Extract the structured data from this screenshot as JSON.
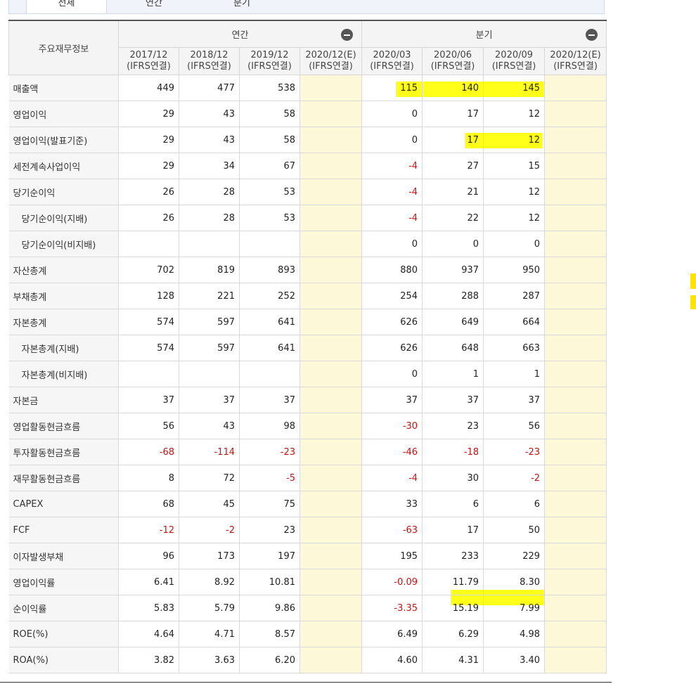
{
  "tabs": [
    {
      "label": "전체"
    },
    {
      "label": "연간"
    },
    {
      "label": "분기"
    }
  ],
  "header": {
    "main_label": "주요재무정보",
    "annual_label": "연간",
    "quarter_label": "분기",
    "periods": [
      {
        "date": "2017/12",
        "basis": "(IFRS연결)"
      },
      {
        "date": "2018/12",
        "basis": "(IFRS연결)"
      },
      {
        "date": "2019/12",
        "basis": "(IFRS연결)"
      },
      {
        "date": "2020/12(E)",
        "basis": "(IFRS연결)"
      },
      {
        "date": "2020/03",
        "basis": "(IFRS연결)"
      },
      {
        "date": "2020/06",
        "basis": "(IFRS연결)"
      },
      {
        "date": "2020/09",
        "basis": "(IFRS연결)"
      },
      {
        "date": "2020/12(E)",
        "basis": "(IFRS연결)"
      }
    ]
  },
  "rows": [
    {
      "label": "매출액",
      "values": [
        "449",
        "477",
        "538",
        "",
        "115",
        "140",
        "145",
        ""
      ]
    },
    {
      "label": "영업이익",
      "values": [
        "29",
        "43",
        "58",
        "",
        "0",
        "17",
        "12",
        ""
      ]
    },
    {
      "label": "영업이익(발표기준)",
      "values": [
        "29",
        "43",
        "58",
        "",
        "0",
        "17",
        "12",
        ""
      ]
    },
    {
      "label": "세전계속사업이익",
      "values": [
        "29",
        "34",
        "67",
        "",
        "-4",
        "27",
        "15",
        ""
      ]
    },
    {
      "label": "당기순이익",
      "values": [
        "26",
        "28",
        "53",
        "",
        "-4",
        "21",
        "12",
        ""
      ]
    },
    {
      "label": "당기순이익(지배)",
      "values": [
        "26",
        "28",
        "53",
        "",
        "-4",
        "22",
        "12",
        ""
      ]
    },
    {
      "label": "당기순이익(비지배)",
      "values": [
        "",
        "",
        "",
        "",
        "0",
        "0",
        "0",
        ""
      ]
    },
    {
      "label": "자산총계",
      "values": [
        "702",
        "819",
        "893",
        "",
        "880",
        "937",
        "950",
        ""
      ]
    },
    {
      "label": "부채총계",
      "values": [
        "128",
        "221",
        "252",
        "",
        "254",
        "288",
        "287",
        ""
      ]
    },
    {
      "label": "자본총계",
      "values": [
        "574",
        "597",
        "641",
        "",
        "626",
        "649",
        "664",
        ""
      ]
    },
    {
      "label": "자본총계(지배)",
      "values": [
        "574",
        "597",
        "641",
        "",
        "626",
        "648",
        "663",
        ""
      ]
    },
    {
      "label": "자본총계(비지배)",
      "values": [
        "",
        "",
        "",
        "",
        "0",
        "1",
        "1",
        ""
      ]
    },
    {
      "label": "자본금",
      "values": [
        "37",
        "37",
        "37",
        "",
        "37",
        "37",
        "37",
        ""
      ]
    },
    {
      "label": "영업활동현금흐름",
      "values": [
        "56",
        "43",
        "98",
        "",
        "-30",
        "23",
        "56",
        ""
      ]
    },
    {
      "label": "투자활동현금흐름",
      "values": [
        "-68",
        "-114",
        "-23",
        "",
        "-46",
        "-18",
        "-23",
        ""
      ]
    },
    {
      "label": "재무활동현금흐름",
      "values": [
        "8",
        "72",
        "-5",
        "",
        "-4",
        "30",
        "-2",
        ""
      ]
    },
    {
      "label": "CAPEX",
      "values": [
        "68",
        "45",
        "75",
        "",
        "33",
        "6",
        "6",
        ""
      ]
    },
    {
      "label": "FCF",
      "values": [
        "-12",
        "-2",
        "23",
        "",
        "-63",
        "17",
        "50",
        ""
      ]
    },
    {
      "label": "이자발생부채",
      "values": [
        "96",
        "173",
        "197",
        "",
        "195",
        "233",
        "229",
        ""
      ]
    },
    {
      "label": "영업이익률",
      "values": [
        "6.41",
        "8.92",
        "10.81",
        "",
        "-0.09",
        "11.79",
        "8.30",
        ""
      ]
    },
    {
      "label": "순이익률",
      "values": [
        "5.83",
        "5.79",
        "9.86",
        "",
        "-3.35",
        "15.19",
        "7.99",
        ""
      ]
    },
    {
      "label": "ROE(%)",
      "values": [
        "4.64",
        "4.71",
        "8.57",
        "",
        "6.49",
        "6.29",
        "4.98",
        ""
      ]
    },
    {
      "label": "ROA(%)",
      "values": [
        "3.82",
        "3.63",
        "6.20",
        "",
        "4.60",
        "4.31",
        "3.40",
        ""
      ]
    }
  ],
  "colors": {
    "highlight": "#ffff00",
    "negative": "#cc1111",
    "estimate_bg": "#fcf8d8"
  }
}
